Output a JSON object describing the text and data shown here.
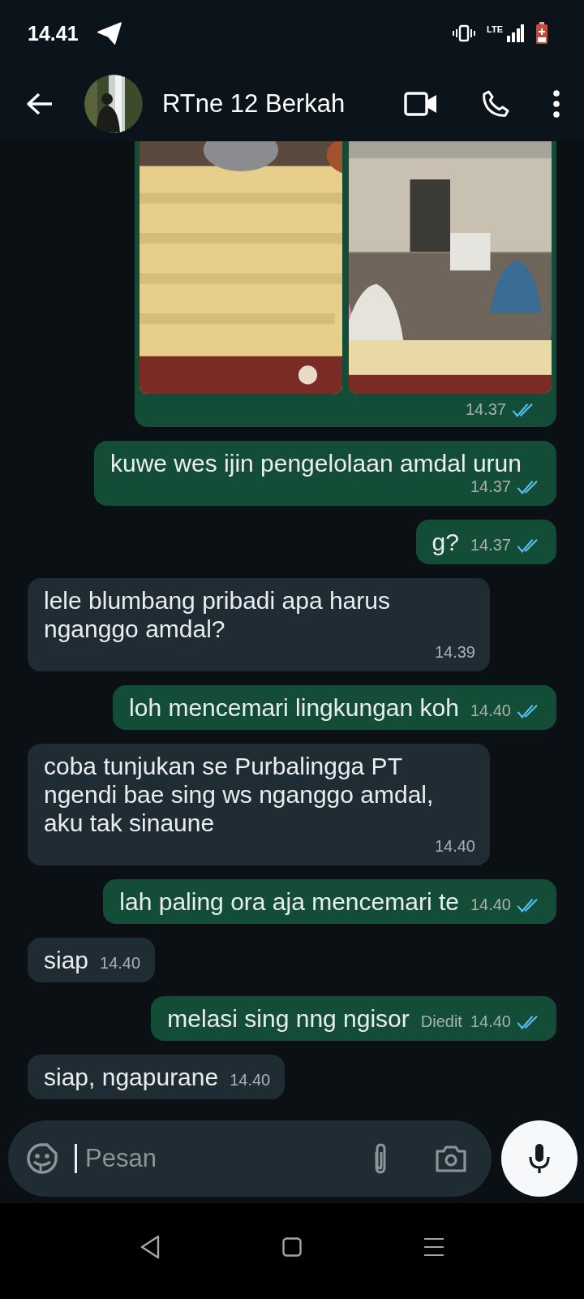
{
  "status_bar": {
    "time": "14.41",
    "network": "LTE"
  },
  "header": {
    "title": "RTne 12 Berkah"
  },
  "messages": [
    {
      "kind": "images",
      "outgoing": true,
      "time": "14.37",
      "read": true
    },
    {
      "kind": "text",
      "outgoing": true,
      "text": "kuwe wes ijin pengelolaan amdal urun",
      "time": "14.37",
      "read": true
    },
    {
      "kind": "text",
      "outgoing": true,
      "text": "g?",
      "time": "14.37",
      "read": true
    },
    {
      "kind": "text",
      "outgoing": false,
      "text": "lele blumbang pribadi apa harus nganggo amdal?",
      "time": "14.39"
    },
    {
      "kind": "text",
      "outgoing": true,
      "text": "loh mencemari lingkungan koh",
      "time": "14.40",
      "read": true
    },
    {
      "kind": "text",
      "outgoing": false,
      "text": "coba tunjukan se Purbalingga PT ngendi bae sing ws nganggo amdal, aku tak sinaune",
      "time": "14.40"
    },
    {
      "kind": "text",
      "outgoing": true,
      "text": "lah paling ora aja mencemari te",
      "time": "14.40",
      "read": true
    },
    {
      "kind": "text",
      "outgoing": false,
      "text": "siap",
      "time": "14.40"
    },
    {
      "kind": "text",
      "outgoing": true,
      "text": "melasi sing nng ngisor",
      "edited": "Diedit",
      "time": "14.40",
      "read": true
    },
    {
      "kind": "text",
      "outgoing": false,
      "text": "siap, ngapurane",
      "time": "14.40"
    }
  ],
  "composer": {
    "placeholder": "Pesan"
  }
}
